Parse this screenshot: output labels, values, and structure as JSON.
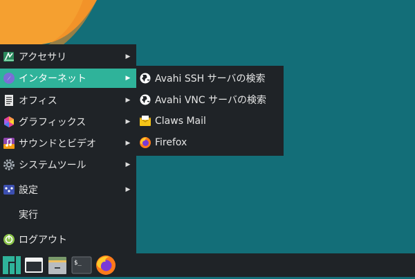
{
  "menu": {
    "items": [
      {
        "label": "アクセサリ",
        "icon": "accessories-icon",
        "has_submenu": true
      },
      {
        "label": "インターネット",
        "icon": "internet-compass-icon",
        "has_submenu": true,
        "active": true
      },
      {
        "label": "オフィス",
        "icon": "office-document-icon",
        "has_submenu": true
      },
      {
        "label": "グラフィックス",
        "icon": "graphics-palette-icon",
        "has_submenu": true
      },
      {
        "label": "サウンドとビデオ",
        "icon": "multimedia-icon",
        "has_submenu": true
      },
      {
        "label": "システムツール",
        "icon": "system-gear-icon",
        "has_submenu": true
      },
      {
        "label": "設定",
        "icon": "settings-icon",
        "has_submenu": true
      },
      {
        "label": "実行",
        "icon": "",
        "has_submenu": false
      },
      {
        "label": "ログアウト",
        "icon": "logout-icon",
        "has_submenu": false
      }
    ]
  },
  "submenu": {
    "items": [
      {
        "label": "Avahi SSH サーバの検索",
        "icon": "globe-icon"
      },
      {
        "label": "Avahi VNC サーバの検索",
        "icon": "globe-icon"
      },
      {
        "label": "Claws Mail",
        "icon": "mail-envelope-icon"
      },
      {
        "label": "Firefox",
        "icon": "firefox-icon"
      }
    ]
  },
  "taskbar": {
    "items": [
      {
        "name": "manjaro-menu-icon"
      },
      {
        "name": "show-desktop-icon"
      },
      {
        "name": "file-manager-icon"
      },
      {
        "name": "terminal-icon",
        "text": "$_"
      },
      {
        "name": "firefox-launcher-icon"
      }
    ]
  },
  "colors": {
    "desktop": "#136e78",
    "accent_orange": "#f5a030",
    "menu_bg": "#1f2327",
    "highlight": "#2fb39a"
  }
}
